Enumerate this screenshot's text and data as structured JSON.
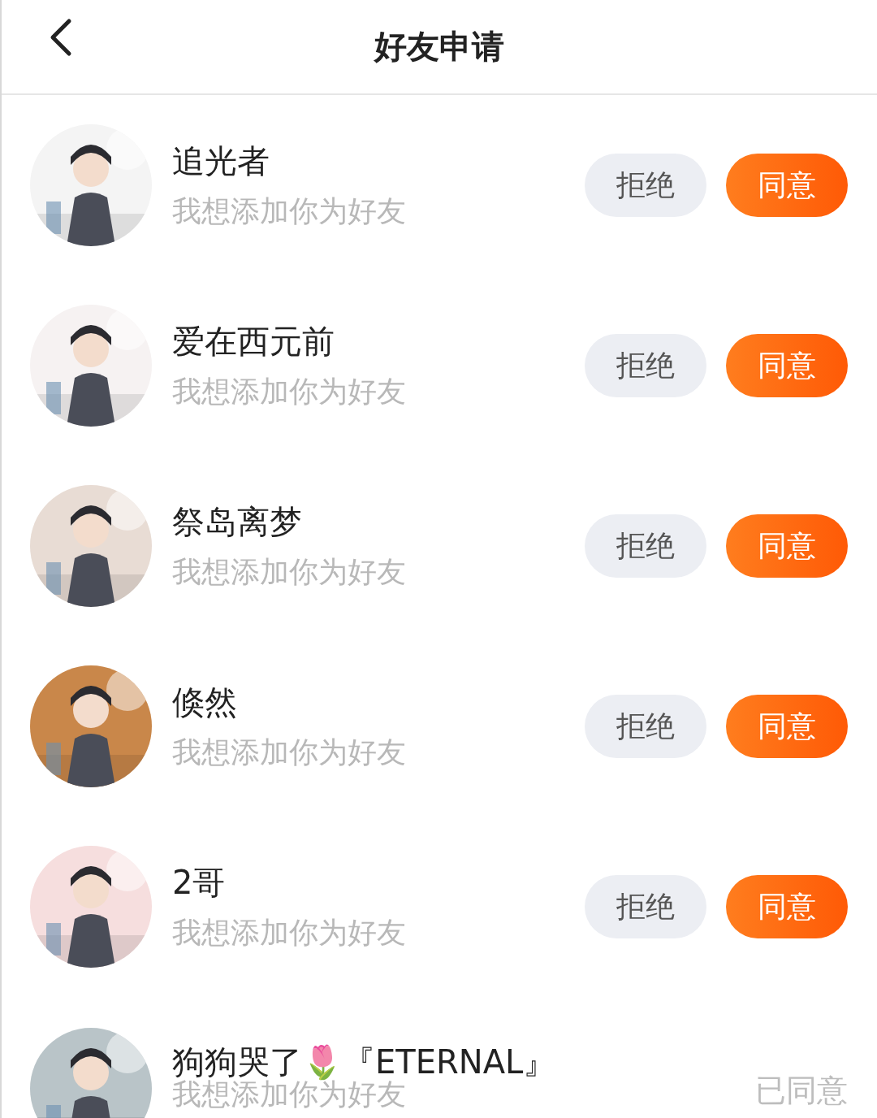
{
  "header": {
    "title": "好友申请"
  },
  "requests": [
    {
      "kind": "pending",
      "name": "追光者",
      "message": "我想添加你为好友",
      "reject": "拒绝",
      "accept": "同意"
    },
    {
      "kind": "pending",
      "name": "爱在西元前",
      "message": "我想添加你为好友",
      "reject": "拒绝",
      "accept": "同意"
    },
    {
      "kind": "pending",
      "name": "祭岛离梦",
      "message": "我想添加你为好友",
      "reject": "拒绝",
      "accept": "同意"
    },
    {
      "kind": "pending",
      "name": "倏然",
      "message": "我想添加你为好友",
      "reject": "拒绝",
      "accept": "同意"
    },
    {
      "kind": "pending",
      "name": "2哥",
      "message": "我想添加你为好友",
      "reject": "拒绝",
      "accept": "同意"
    },
    {
      "kind": "accepted",
      "name": "狗狗哭了🌷『ETERNAL』",
      "message": "我想添加你为好友",
      "status": "已同意"
    }
  ]
}
